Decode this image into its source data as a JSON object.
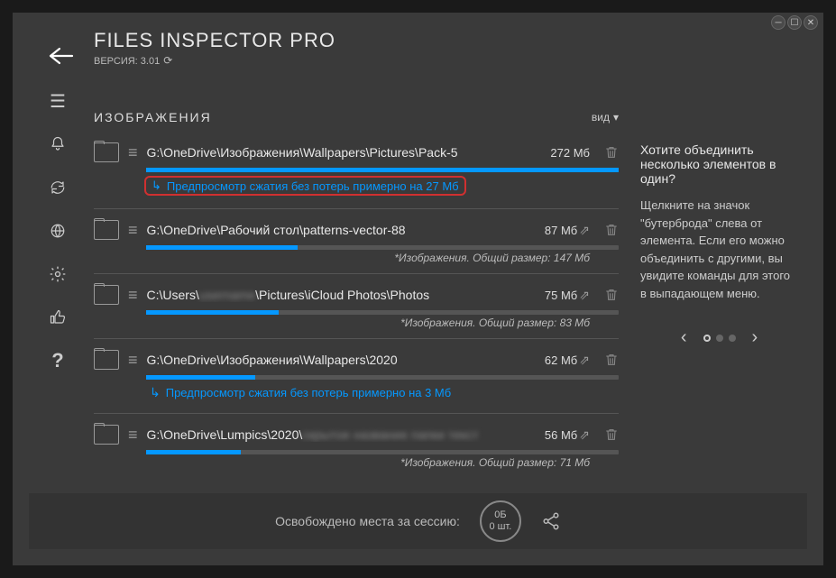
{
  "app": {
    "title": "FILES INSPECTOR PRO",
    "version": "ВЕРСИЯ: 3.01"
  },
  "section": {
    "title": "ИЗОБРАЖЕНИЯ",
    "viewLabel": "вид"
  },
  "items": [
    {
      "path": "G:\\OneDrive\\Изображения\\Wallpapers\\Pictures\\Pack-5",
      "size": "272 Мб",
      "barPct": 100,
      "preview": "Предпросмотр сжатия без потерь примерно на 27 Мб",
      "highlighted": true,
      "linkable": false
    },
    {
      "path": "G:\\OneDrive\\Рабочий стол\\patterns-vector-88",
      "size": "87 Мб",
      "barPct": 32,
      "subtext": "*Изображения. Общий размер: 147 Мб",
      "linkable": true
    },
    {
      "path": "C:\\Users\\▮▮▮▮\\Pictures\\iCloud Photos\\Photos",
      "size": "75 Мб",
      "barPct": 28,
      "subtext": "*Изображения. Общий размер: 83 Мб",
      "linkable": true,
      "blurSegment": true
    },
    {
      "path": "G:\\OneDrive\\Изображения\\Wallpapers\\2020",
      "size": "62 Мб",
      "barPct": 23,
      "preview": "Предпросмотр сжатия без потерь примерно на 3 Мб",
      "linkable": true
    },
    {
      "path": "G:\\OneDrive\\Lumpics\\2020\\▮▮▮▮▮▮▮▮▮▮▮▮",
      "size": "56 Мб",
      "barPct": 20,
      "subtext": "*Изображения. Общий размер: 71 Мб",
      "linkable": true,
      "blurTail": true
    }
  ],
  "tip": {
    "title": "Хотите объединить несколько элементов в один?",
    "body": "Щелкните на значок \"бутерброда\" слева от элемента. Если его можно объединить с другими, вы увидите команды для этого в выпадающем меню."
  },
  "footer": {
    "label": "Освобождено места за сессию:",
    "sizeTop": "0Б",
    "sizeBottom": "0 шт."
  }
}
